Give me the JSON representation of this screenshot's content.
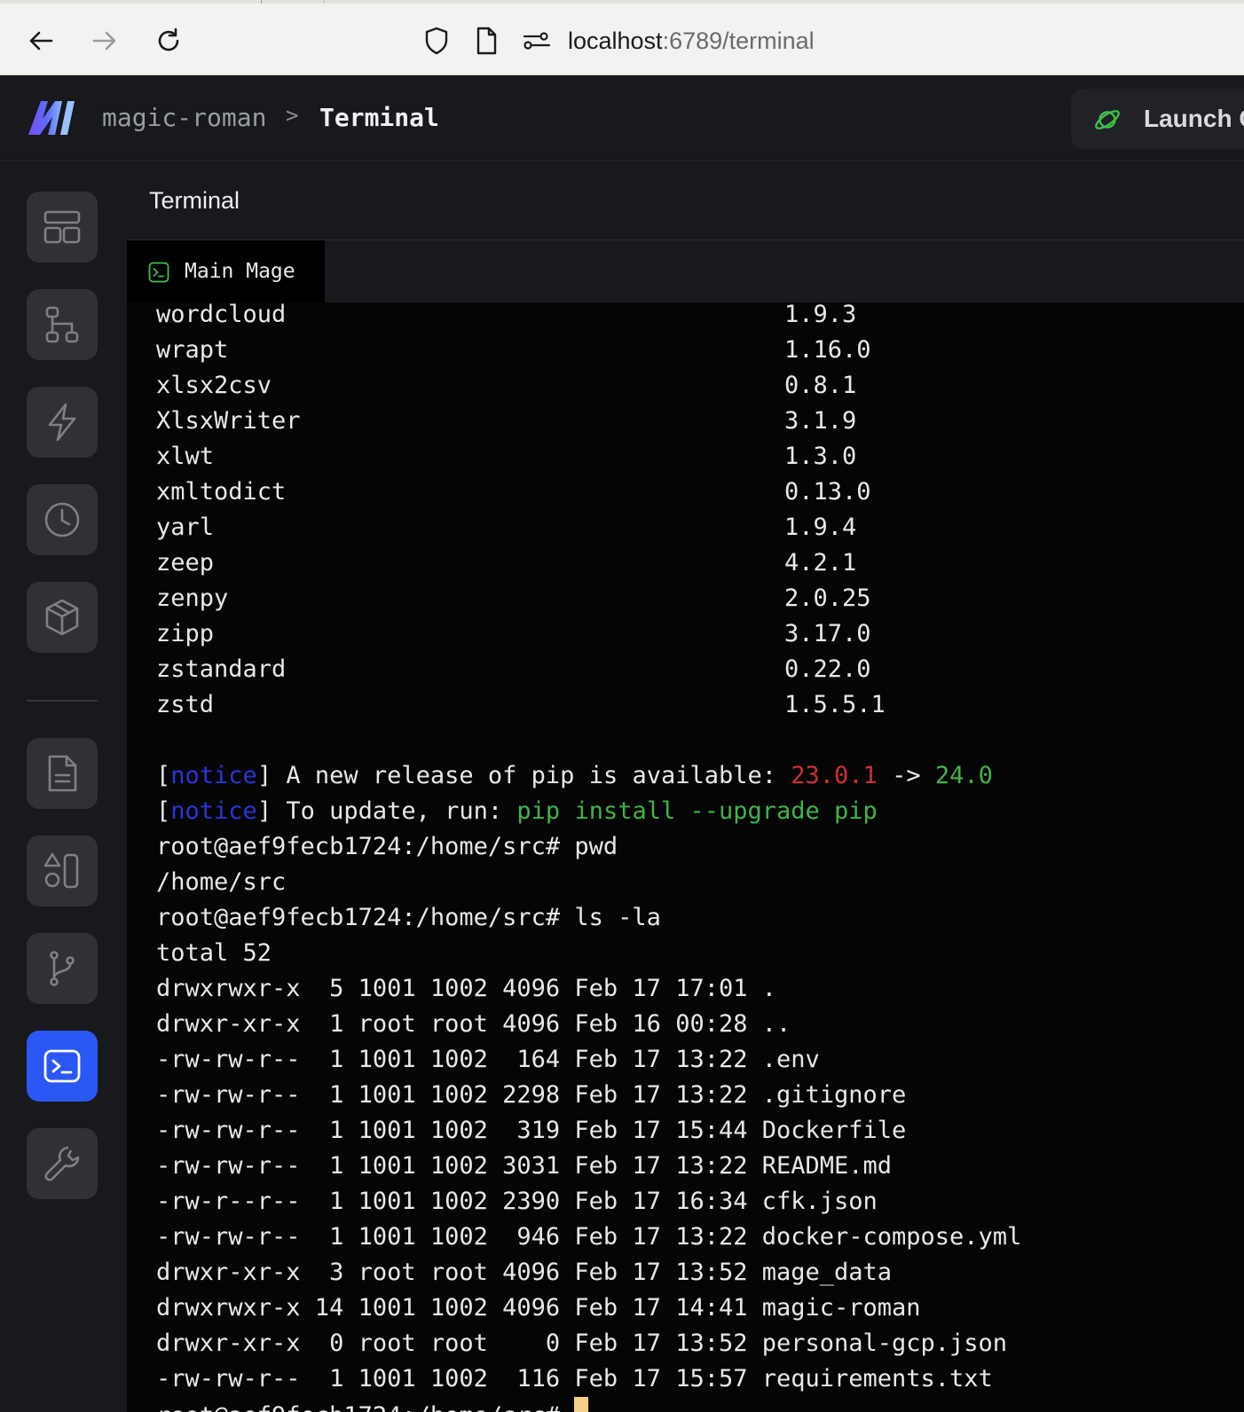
{
  "browser": {
    "url_host": "localhost",
    "url_path": ":6789/terminal"
  },
  "header": {
    "project": "magic-roman",
    "separator": ">",
    "current_page": "Terminal",
    "launch_label": "Launch C"
  },
  "panel": {
    "title": "Terminal",
    "tab_label": "Main Mage"
  },
  "sidebar": {
    "items": [
      "overview",
      "pipelines",
      "triggers",
      "pipeline-runs",
      "blocks",
      "files",
      "templates",
      "version-control",
      "terminal",
      "settings"
    ],
    "active": "terminal"
  },
  "packages": [
    {
      "name": "wordcloud",
      "version": "1.9.3"
    },
    {
      "name": "wrapt",
      "version": "1.16.0"
    },
    {
      "name": "xlsx2csv",
      "version": "0.8.1"
    },
    {
      "name": "XlsxWriter",
      "version": "3.1.9"
    },
    {
      "name": "xlwt",
      "version": "1.3.0"
    },
    {
      "name": "xmltodict",
      "version": "0.13.0"
    },
    {
      "name": "yarl",
      "version": "1.9.4"
    },
    {
      "name": "zeep",
      "version": "4.2.1"
    },
    {
      "name": "zenpy",
      "version": "2.0.25"
    },
    {
      "name": "zipp",
      "version": "3.17.0"
    },
    {
      "name": "zstandard",
      "version": "0.22.0"
    },
    {
      "name": "zstd",
      "version": "1.5.5.1"
    }
  ],
  "notice1": {
    "open": "[",
    "tag": "notice",
    "close": "]",
    "text": " A new release of pip is available: ",
    "old_version": "23.0.1",
    "arrow": " -> ",
    "new_version": "24.0"
  },
  "notice2": {
    "open": "[",
    "tag": "notice",
    "close": "]",
    "text": " To update, run: ",
    "command": "pip install --upgrade pip"
  },
  "session": [
    "root@aef9fecb1724:/home/src# pwd",
    "/home/src",
    "root@aef9fecb1724:/home/src# ls -la",
    "total 52",
    "drwxrwxr-x  5 1001 1002 4096 Feb 17 17:01 .",
    "drwxr-xr-x  1 root root 4096 Feb 16 00:28 ..",
    "-rw-rw-r--  1 1001 1002  164 Feb 17 13:22 .env",
    "-rw-rw-r--  1 1001 1002 2298 Feb 17 13:22 .gitignore",
    "-rw-rw-r--  1 1001 1002  319 Feb 17 15:44 Dockerfile",
    "-rw-rw-r--  1 1001 1002 3031 Feb 17 13:22 README.md",
    "-rw-r--r--  1 1001 1002 2390 Feb 17 16:34 cfk.json",
    "-rw-rw-r--  1 1001 1002  946 Feb 17 13:22 docker-compose.yml",
    "drwxr-xr-x  3 root root 4096 Feb 17 13:52 mage_data",
    "drwxrwxr-x 14 1001 1002 4096 Feb 17 14:41 magic-roman",
    "drwxr-xr-x  0 root root    0 Feb 17 13:52 personal-gcp.json",
    "-rw-rw-r--  1 1001 1002  116 Feb 17 15:57 requirements.txt"
  ],
  "prompt": "root@aef9fecb1724:/home/src# ",
  "colors": {
    "accent_active": "#2b57f5",
    "notice_tag": "#2a34d6",
    "old_version": "#cf2f2f",
    "new_version": "#3fb44a"
  }
}
